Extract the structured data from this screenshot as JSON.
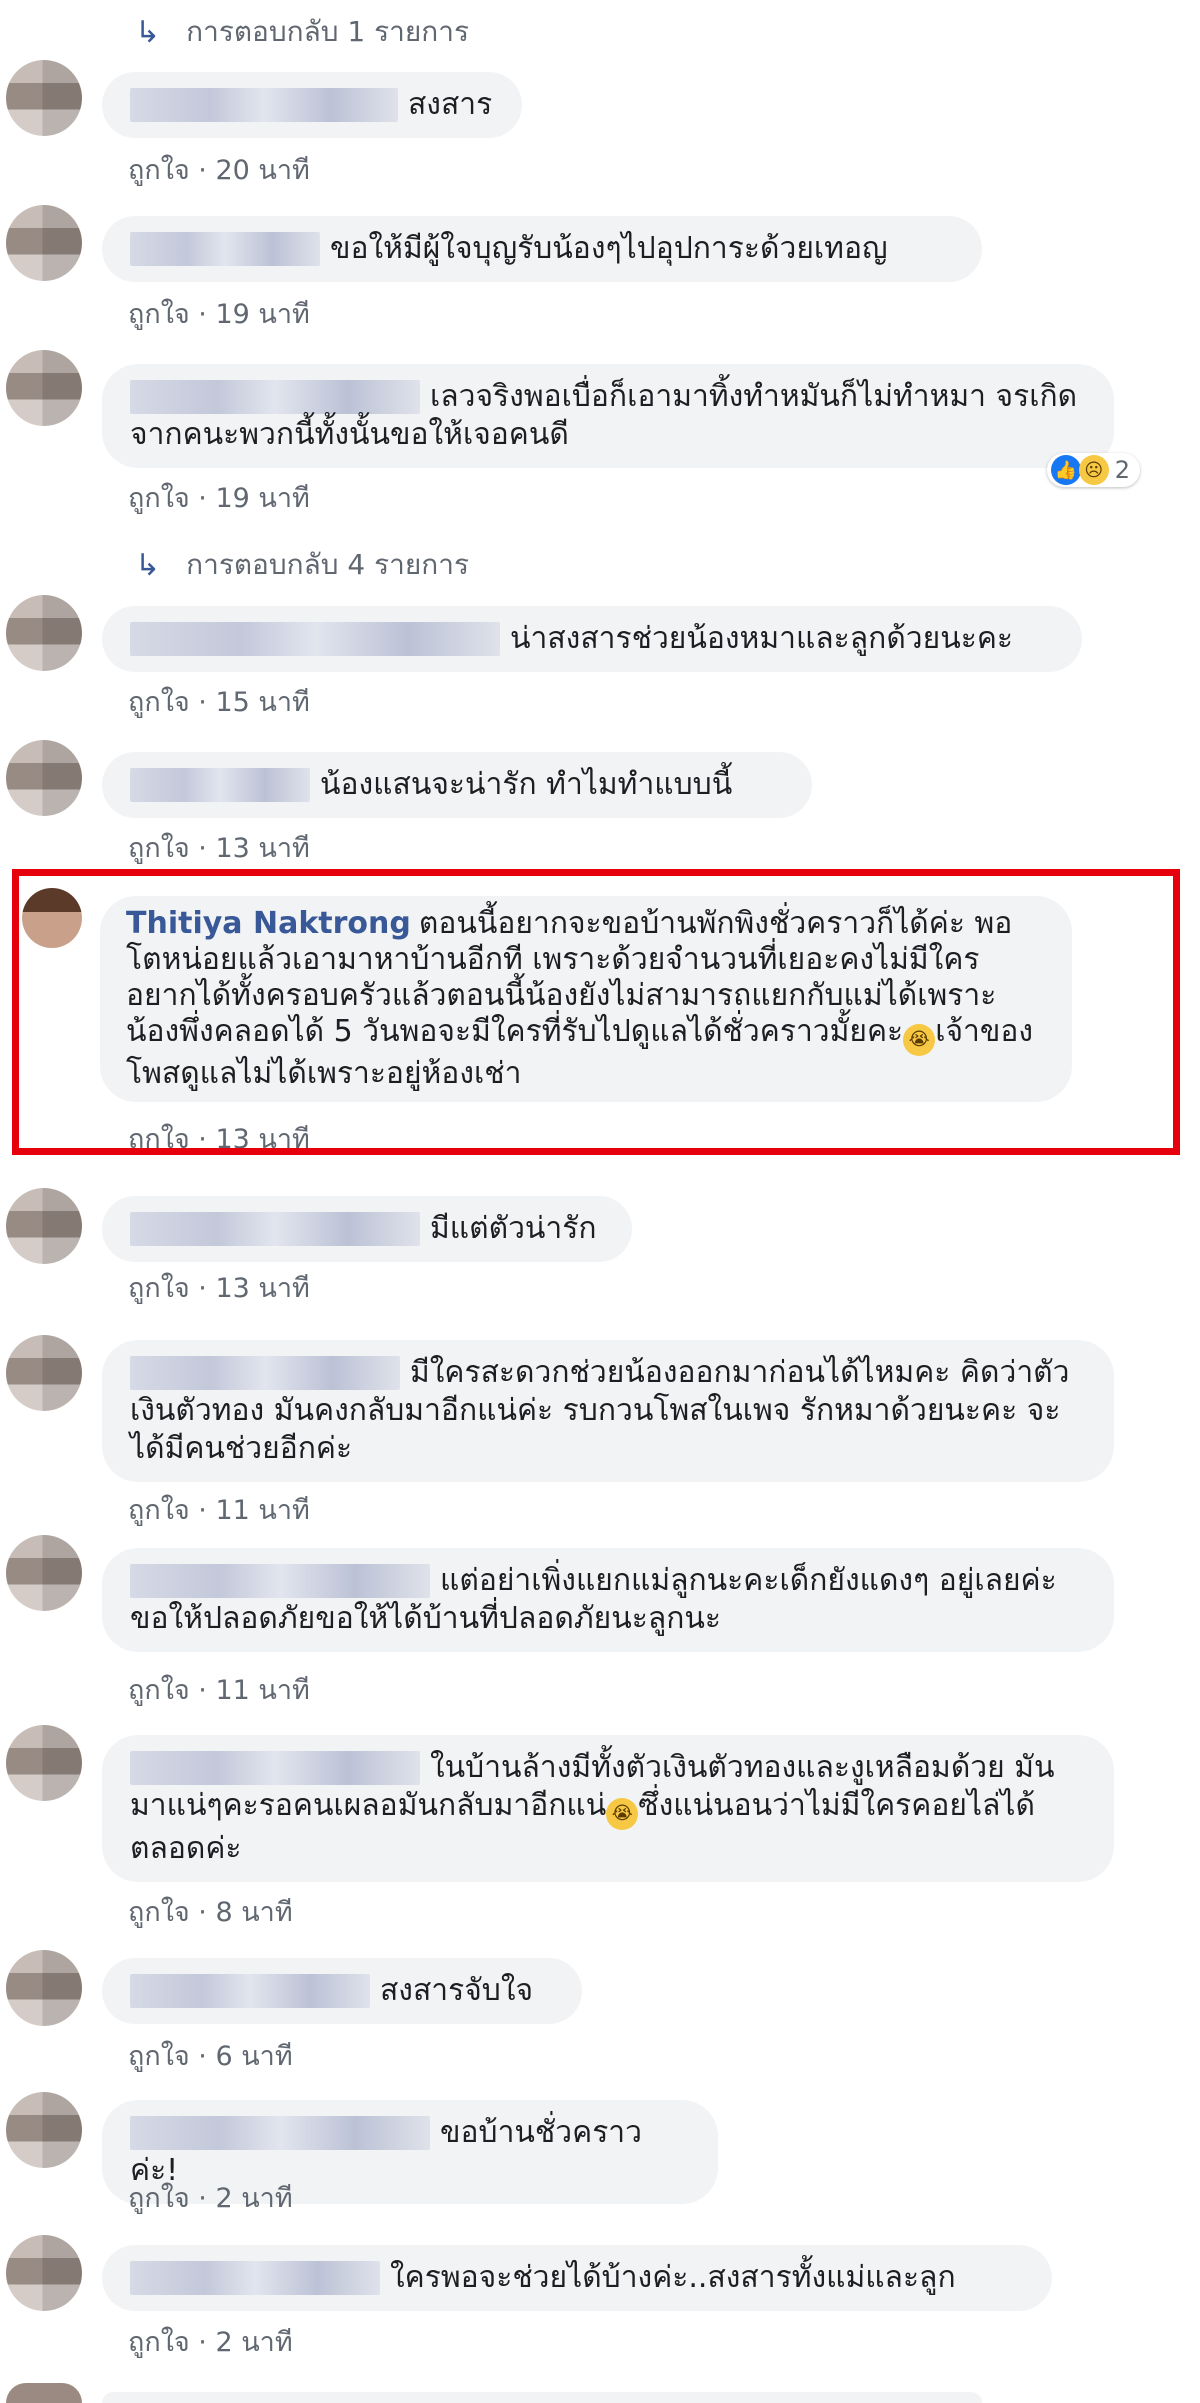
{
  "reply_top": {
    "label": "การตอบกลับ 1 รายการ"
  },
  "reply_mid": {
    "label": "การตอบกลับ 4 รายการ"
  },
  "colors": {
    "highlight": "#e5000c",
    "name_link": "#385898",
    "meta": "#606770",
    "bubble_bg": "#f2f3f5"
  },
  "comments": [
    {
      "text": "สงสาร",
      "meta": "ถูกใจ · 20 นาที"
    },
    {
      "text": "ขอให้มีผู้ใจบุญรับน้องๆไปอุปการะด้วยเทอญ",
      "meta": "ถูกใจ · 19 นาที"
    },
    {
      "text": "เลวจริงพอเบื่อก็เอามาทิ้งทำหมันก็ไม่ทำหมา จรเกิดจากคนะพวกนี้ทั้งนั้นขอให้เจอคนดี",
      "meta": "ถูกใจ · 19 นาที",
      "reaction_count": "2"
    },
    {
      "text": "น่าสงสารช่วยน้องหมาและลูกด้วยนะคะ",
      "meta": "ถูกใจ · 15 นาที"
    },
    {
      "text": "น้องแสนจะน่ารัก ทำไมทำแบบนี้",
      "meta": "ถูกใจ · 13 นาที"
    },
    {
      "name": "Thitiya Naktrong",
      "text": "ตอนนี้อยากจะขอบ้านพักพิงชั่วคราวก็ได้ค่ะ พอโตหน่อยแล้วเอามาหาบ้านอีกที เพราะด้วยจำนวนที่เยอะคงไม่มีใครอยากได้ทั้งครอบครัวแล้วตอนนี้น้องยังไม่สามารถแยกกับแม่ได้เพราะน้องพึ่งคลอดได้ 5 วันพอจะมีใครที่รับไปดูแลได้ชั่วคราวมั้ยคะ",
      "text_after": "เจ้าของโพสดูแลไม่ได้เพราะอยู่ห้องเช่า",
      "meta": "ถูกใจ · 13 นาที"
    },
    {
      "text": "มีแต่ตัวน่ารัก",
      "meta": "ถูกใจ · 13 นาที"
    },
    {
      "text": "มีใครสะดวกช่วยน้องออกมาก่อนได้ไหมคะ คิดว่าตัวเงินตัวทอง มันคงกลับมาอีกแน่ค่ะ รบกวนโพสในเพจ รักหมาด้วยนะคะ จะได้มีคนช่วยอีกค่ะ",
      "meta": "ถูกใจ · 11 นาที"
    },
    {
      "text": "แต่อย่าเพิ่งแยกแม่ลูกนะคะเด็กยังแดงๆ อยู่เลยค่ะ ขอให้ปลอดภัยขอให้ได้บ้านที่ปลอดภัยนะลูกนะ",
      "meta": "ถูกใจ · 11 นาที"
    },
    {
      "text": "ในบ้านล้างมีทั้งตัวเงินตัวทองและงูเหลือมด้วย มันมาแน่ๆคะรอคนเผลอมันกลับมาอีกแน่",
      "text_after": "ซึ่งแน่นอนว่าไม่มีใครคอยไล่ได้ตลอดค่ะ",
      "meta": "ถูกใจ · 8 นาที"
    },
    {
      "text": "สงสารจับใจ",
      "meta": "ถูกใจ · 6 นาที"
    },
    {
      "text": "ขอบ้านชั่วคราวค่ะ!",
      "meta": "ถูกใจ · 2 นาที"
    },
    {
      "text": "ใครพอจะช่วยได้บ้างค่ะ..สงสารทั้งแม่และลูก",
      "meta": "ถูกใจ · 2 นาที"
    }
  ]
}
